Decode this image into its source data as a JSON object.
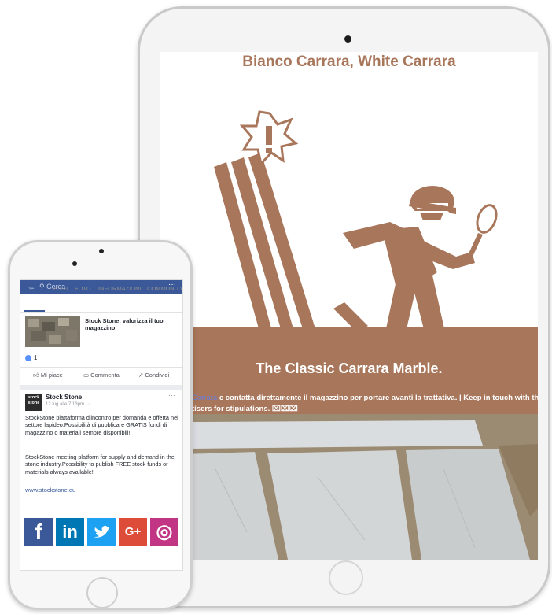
{
  "tablet": {
    "title": "Bianco Carrara, White Carrara",
    "banner_title": "The Classic Carrara Marble.",
    "banner_link": " Carrara",
    "banner_line1": " e contatta direttamente il magazzino per portare avanti la trattativa. | Keep in touch with the",
    "banner_line2": "tisers for stipulations. ⌧⌧⌧",
    "colors": {
      "brand": "#a8765a"
    }
  },
  "phone": {
    "search_placeholder": "Cerca",
    "tabs": [
      "HOME",
      "POST",
      "FOTO",
      "INFORMAZIONI",
      "COMMUNITY"
    ],
    "shared_post_title": "Stock Stone: valorizza il tuo magazzino",
    "reaction_count": "1",
    "actions": {
      "like": "Mi piace",
      "comment": "Commenta",
      "share": "Condividi"
    },
    "post": {
      "avatar_text": "stock stone",
      "author": "Stock Stone",
      "time": "12 lug alle 7:13pm · ",
      "text_it": "StockStone piattaforma d'incontro per domanda e offerta nel settore lapideo.Possibilità di pubblicare GRATIS fondi di magazzino o materiali sempre disponibili!",
      "text_en": "StockStone meeting platform for supply and demand in the stone industry.Possibility to publish FREE stock funds or materials always available!",
      "link": "www.stockstone.eu"
    },
    "social": {
      "facebook": {
        "glyph": "f",
        "color": "#3b5998"
      },
      "linkedin": {
        "glyph": "in",
        "color": "#0077b5"
      },
      "twitter": {
        "glyph": "t",
        "color": "#1da1f2"
      },
      "googleplus": {
        "glyph": "G+",
        "color": "#dd4b39"
      },
      "instagram": {
        "glyph": "◎",
        "color": "#c13584"
      }
    }
  }
}
